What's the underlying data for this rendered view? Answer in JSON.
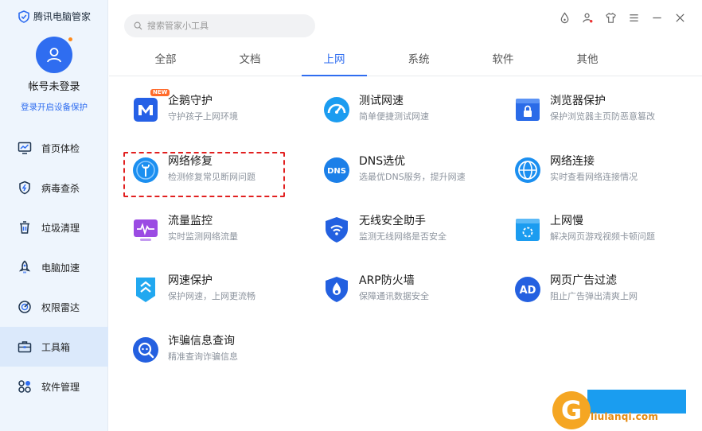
{
  "app": {
    "title": "腾讯电脑管家"
  },
  "account": {
    "name": "帐号未登录",
    "login_link": "登录开启设备保护"
  },
  "sidebar": {
    "items": [
      {
        "label": "首页体检",
        "icon": "monitor-icon",
        "active": false
      },
      {
        "label": "病毒查杀",
        "icon": "shield-bolt-icon",
        "active": false
      },
      {
        "label": "垃圾清理",
        "icon": "trash-icon",
        "active": false
      },
      {
        "label": "电脑加速",
        "icon": "rocket-icon",
        "active": false
      },
      {
        "label": "权限雷达",
        "icon": "radar-icon",
        "active": false
      },
      {
        "label": "工具箱",
        "icon": "toolbox-icon",
        "active": true
      },
      {
        "label": "软件管理",
        "icon": "apps-icon",
        "active": false
      }
    ]
  },
  "search": {
    "placeholder": "搜索管家小工具"
  },
  "window_controls": [
    "skin-icon",
    "user-settings-icon",
    "shirt-icon",
    "menu-icon",
    "minimize-icon",
    "close-icon"
  ],
  "tabs": [
    {
      "label": "全部",
      "active": false
    },
    {
      "label": "文档",
      "active": false
    },
    {
      "label": "上网",
      "active": true
    },
    {
      "label": "系统",
      "active": false
    },
    {
      "label": "软件",
      "active": false
    },
    {
      "label": "其他",
      "active": false
    }
  ],
  "tools": [
    {
      "title": "企鹅守护",
      "desc": "守护孩子上网环境",
      "icon": "penguin-guard-icon",
      "badge": "NEW"
    },
    {
      "title": "测试网速",
      "desc": "简单便捷测试网速",
      "icon": "speedometer-icon"
    },
    {
      "title": "浏览器保护",
      "desc": "保护浏览器主页防恶意篡改",
      "icon": "browser-lock-icon"
    },
    {
      "title": "网络修复",
      "desc": "检测修复常见断网问题",
      "icon": "wrench-globe-icon",
      "highlighted": true
    },
    {
      "title": "DNS选优",
      "desc": "选最优DNS服务，提升网速",
      "icon": "dns-icon"
    },
    {
      "title": "网络连接",
      "desc": "实时查看网络连接情况",
      "icon": "globe-icon"
    },
    {
      "title": "流量监控",
      "desc": "实时监测网络流量",
      "icon": "traffic-monitor-icon"
    },
    {
      "title": "无线安全助手",
      "desc": "监测无线网络是否安全",
      "icon": "wifi-shield-icon"
    },
    {
      "title": "上网慢",
      "desc": "解决网页游戏视频卡顿问题",
      "icon": "slow-network-icon"
    },
    {
      "title": "网速保护",
      "desc": "保护网速，上网更流畅",
      "icon": "speed-protect-icon"
    },
    {
      "title": "ARP防火墙",
      "desc": "保障通讯数据安全",
      "icon": "arp-firewall-icon"
    },
    {
      "title": "网页广告过滤",
      "desc": "阻止广告弹出清爽上网",
      "icon": "ad-filter-icon"
    },
    {
      "title": "诈骗信息查询",
      "desc": "精准查询诈骗信息",
      "icon": "fraud-search-icon"
    }
  ],
  "watermark": {
    "text": "liulanqi.com"
  },
  "colors": {
    "accent": "#2f6df0",
    "sidebar_bg": "#eef5fd",
    "highlight": "#e12020"
  }
}
